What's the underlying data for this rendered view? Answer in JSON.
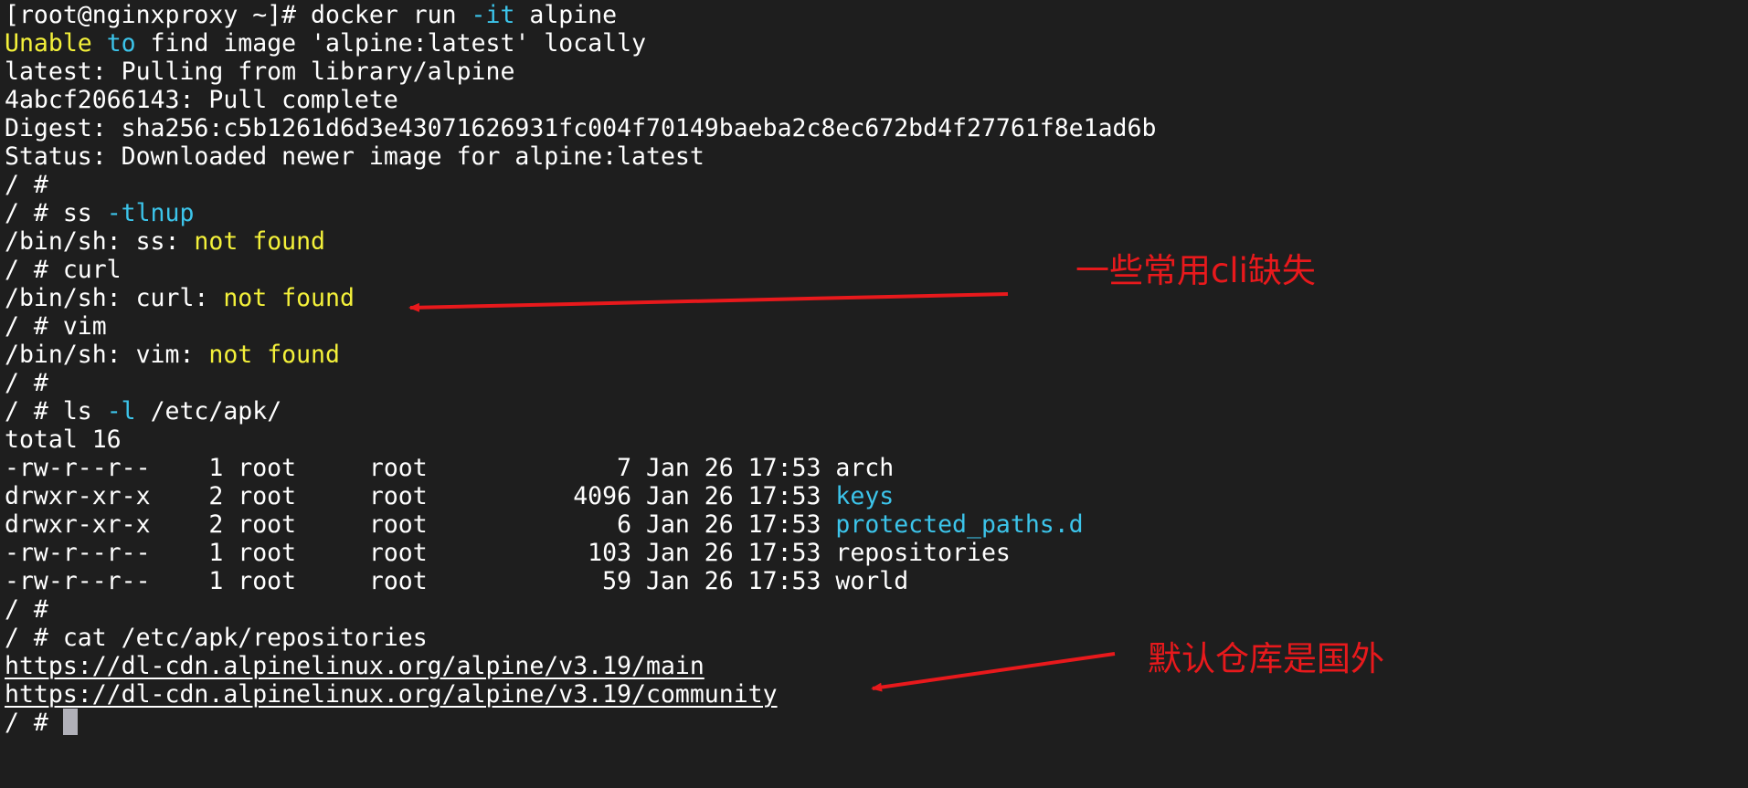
{
  "terminal": {
    "colors": {
      "background": "#1e1e1e",
      "text": "#ffffff",
      "yellow": "#f4f13a",
      "cyan": "#3cc4ea",
      "annotation": "#e8191c",
      "cursor": "#b0b0b8"
    },
    "lines": [
      [
        {
          "t": "[root@nginxproxy ~]# docker run "
        },
        {
          "t": "-it",
          "c": "cyan"
        },
        {
          "t": " alpine"
        }
      ],
      [
        {
          "t": "Unable",
          "c": "yellow"
        },
        {
          "t": " "
        },
        {
          "t": "to",
          "c": "cyan"
        },
        {
          "t": " find image 'alpine:latest' locally"
        }
      ],
      [
        {
          "t": "latest: Pulling from library/alpine"
        }
      ],
      [
        {
          "t": "4abcf2066143: Pull complete"
        }
      ],
      [
        {
          "t": "Digest: sha256:c5b1261d6d3e43071626931fc004f70149baeba2c8ec672bd4f27761f8e1ad6b"
        }
      ],
      [
        {
          "t": "Status: Downloaded newer image for alpine:latest"
        }
      ],
      [
        {
          "t": "/ #"
        }
      ],
      [
        {
          "t": "/ # ss "
        },
        {
          "t": "-tlnup",
          "c": "cyan"
        }
      ],
      [
        {
          "t": "/bin/sh: ss: "
        },
        {
          "t": "not found",
          "c": "yellow"
        }
      ],
      [
        {
          "t": "/ # curl"
        }
      ],
      [
        {
          "t": "/bin/sh: curl: "
        },
        {
          "t": "not found",
          "c": "yellow"
        }
      ],
      [
        {
          "t": "/ # vim"
        }
      ],
      [
        {
          "t": "/bin/sh: vim: "
        },
        {
          "t": "not found",
          "c": "yellow"
        }
      ],
      [
        {
          "t": "/ #"
        }
      ],
      [
        {
          "t": "/ # ls "
        },
        {
          "t": "-l",
          "c": "cyan"
        },
        {
          "t": " /etc/apk/"
        }
      ],
      [
        {
          "t": "total 16"
        }
      ],
      [
        {
          "t": "-rw-r--r--    1 root     root             7 Jan 26 17:53 arch"
        }
      ],
      [
        {
          "t": "drwxr-xr-x    2 root     root          4096 Jan 26 17:53 "
        },
        {
          "t": "keys",
          "c": "cyan"
        }
      ],
      [
        {
          "t": "drwxr-xr-x    2 root     root             6 Jan 26 17:53 "
        },
        {
          "t": "protected_paths.d",
          "c": "cyan"
        }
      ],
      [
        {
          "t": "-rw-r--r--    1 root     root           103 Jan 26 17:53 repositories"
        }
      ],
      [
        {
          "t": "-rw-r--r--    1 root     root            59 Jan 26 17:53 world"
        }
      ],
      [
        {
          "t": "/ #"
        }
      ],
      [
        {
          "t": "/ # cat /etc/apk/repositories"
        }
      ],
      [
        {
          "t": "https://dl-cdn.alpinelinux.org/alpine/v3.19/main",
          "c": "url"
        }
      ],
      [
        {
          "t": "https://dl-cdn.alpinelinux.org/alpine/v3.19/community",
          "c": "url"
        }
      ],
      [
        {
          "t": "/ # "
        },
        {
          "cursor": true
        }
      ]
    ]
  },
  "annotations": {
    "missing_cli": "一些常用cli缺失",
    "foreign_repo": "默认仓库是国外"
  }
}
